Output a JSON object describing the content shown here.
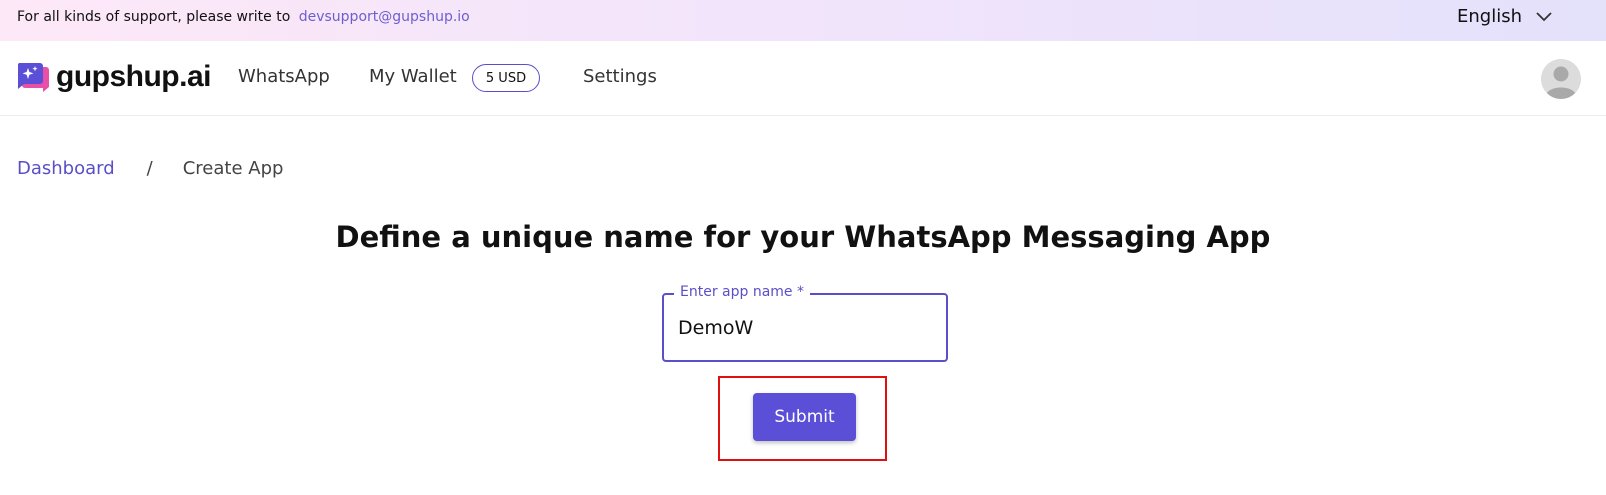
{
  "topbar": {
    "support_text": "For all kinds of support, please write to",
    "support_email": "devsupport@gupshup.io",
    "language": "English"
  },
  "nav": {
    "logo_text": "gupshup.ai",
    "items": [
      "WhatsApp",
      "My Wallet",
      "Settings"
    ],
    "wallet_balance": "5 USD"
  },
  "breadcrumb": {
    "home": "Dashboard",
    "separator": "/",
    "current": "Create App"
  },
  "main": {
    "headline": "Define a unique name for your WhatsApp Messaging App",
    "app_name_label": "Enter app name *",
    "app_name_value": "DemoW",
    "submit_label": "Submit"
  },
  "colors": {
    "accent": "#5a4fd6",
    "highlight": "#e01010"
  },
  "icons": {
    "logo": "chat-bubble-sparkle-icon",
    "language": "chevron-down-icon",
    "avatar": "user-avatar-icon"
  }
}
